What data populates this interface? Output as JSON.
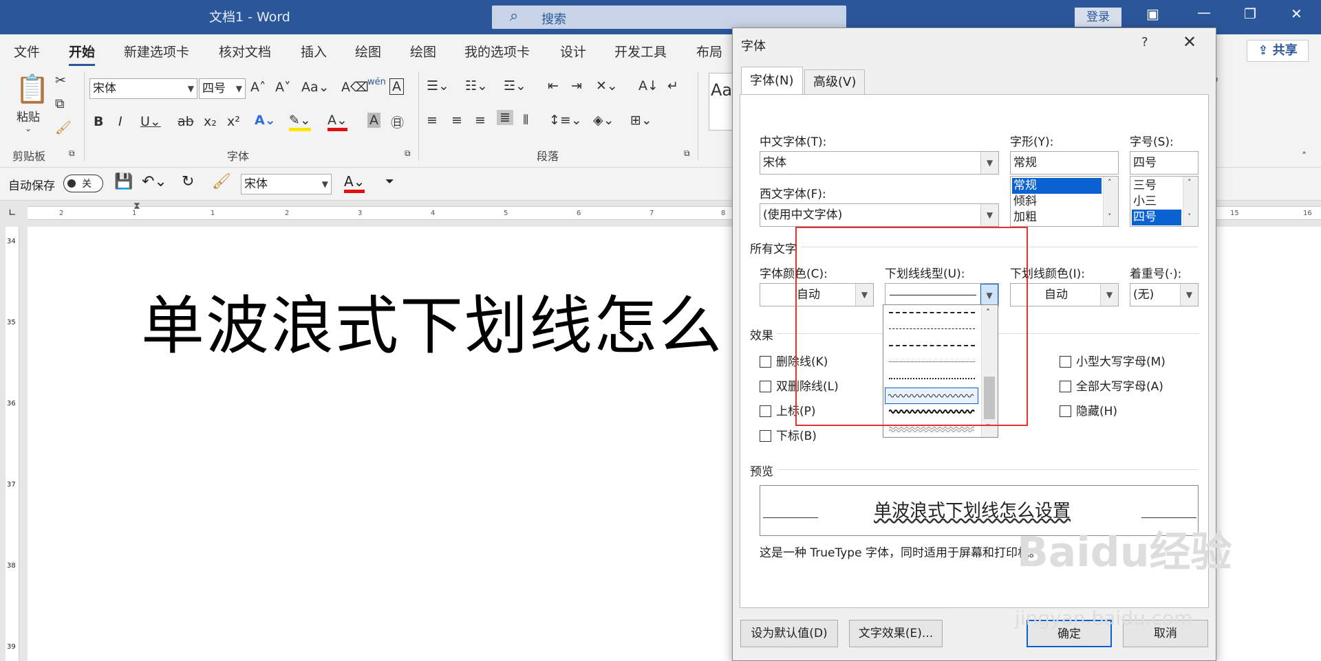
{
  "window": {
    "title": "文档1  -  Word",
    "search_placeholder": "搜索",
    "login": "登录",
    "share": "共享"
  },
  "tabs": [
    "文件",
    "开始",
    "新建选项卡",
    "核对文档",
    "插入",
    "绘图",
    "绘图",
    "我的选项卡",
    "设计",
    "开发工具",
    "布局"
  ],
  "ribbon": {
    "groups": {
      "clipboard": "剪贴板",
      "font": "字体",
      "paragraph": "段落"
    },
    "paste_label": "粘贴",
    "font_name": "宋体",
    "font_size": "四号",
    "style_preview": "Aa"
  },
  "qat": {
    "autosave_label": "自动保存",
    "autosave_state": "关",
    "font_name": "宋体"
  },
  "ruler_numbers": [
    "2",
    "1",
    "",
    "1",
    "2",
    "3",
    "4",
    "5",
    "6",
    "7",
    "8"
  ],
  "ruler_right_numbers": [
    "15",
    "16"
  ],
  "vruler_numbers": [
    "34",
    "35",
    "36",
    "37",
    "38",
    "39"
  ],
  "document": {
    "text": "单波浪式下划线怎么"
  },
  "dialog": {
    "title": "字体",
    "help": "?",
    "tabs": [
      "字体(N)",
      "高级(V)"
    ],
    "chinese_font_label": "中文字体(T):",
    "chinese_font_value": "宋体",
    "western_font_label": "西文字体(F):",
    "western_font_value": "(使用中文字体)",
    "style_label": "字形(Y):",
    "style_value": "常规",
    "style_options": [
      "常规",
      "倾斜",
      "加粗"
    ],
    "size_label": "字号(S):",
    "size_value": "四号",
    "size_options": [
      "三号",
      "小三",
      "四号"
    ],
    "all_text_section": "所有文字",
    "font_color_label": "字体颜色(C):",
    "font_color_value": "自动",
    "underline_style_label": "下划线线型(U):",
    "underline_color_label": "下划线颜色(I):",
    "underline_color_value": "自动",
    "emphasis_label": "着重号(·):",
    "emphasis_value": "(无)",
    "effects_section": "效果",
    "effects_left": [
      "删除线(K)",
      "双删除线(L)",
      "上标(P)",
      "下标(B)"
    ],
    "effects_right": [
      "小型大写字母(M)",
      "全部大写字母(A)",
      "隐藏(H)"
    ],
    "preview_section": "预览",
    "preview_text": "单波浪式下划线怎么设置",
    "truetype_note": "这是一种 TrueType 字体，同时适用于屏幕和打印机。",
    "btn_default": "设为默认值(D)",
    "btn_effects": "文字效果(E)...",
    "btn_ok": "确定",
    "btn_cancel": "取消"
  },
  "watermark": {
    "logo": "Baidu经验",
    "url": "jingyan.baidu.com"
  }
}
